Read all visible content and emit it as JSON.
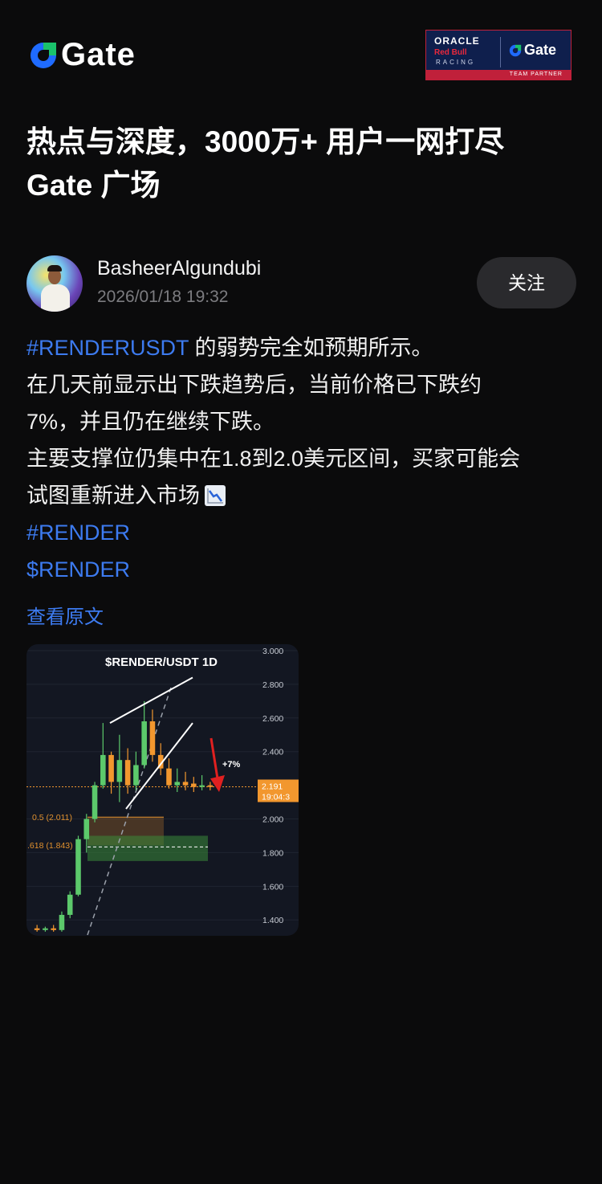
{
  "header": {
    "logo_text": "Gate",
    "partner": {
      "oracle": "ORACLE",
      "redbull": "Red Bull",
      "racing": "RACING",
      "gate": "Gate",
      "team_partner": "TEAM PARTNER"
    }
  },
  "headline": {
    "line1": "热点与深度，3000万+ 用户一网打尽",
    "line2": "Gate 广场"
  },
  "author": {
    "name": "BasheerAlgundubi",
    "time": "2026/01/18 19:32",
    "follow_label": "关注"
  },
  "post": {
    "tag_main": "#RENDERUSDT",
    "line1_rest": " 的弱势完全如预期所示。",
    "line2": "在几天前显示出下跌趋势后，当前价格已下跌约",
    "line3": "7%，并且仍在继续下跌。",
    "line4": "主要支撑位仍集中在1.8到2.0美元区间，买家可能会",
    "line5": "试图重新进入市场",
    "emoji": "chart-decreasing-icon",
    "hashtag": "#RENDER",
    "cashtag": "$RENDER",
    "view_original": "查看原文"
  },
  "colors": {
    "link": "#3d7bf0",
    "brand_blue": "#1f6bff",
    "brand_green": "#1ac26b",
    "bull": "#5cc96b",
    "bear": "#f2972e",
    "arrow": "#e02020"
  },
  "chart_data": {
    "type": "candlestick",
    "title": "$RENDER/USDT 1D",
    "y_ticks": [
      "3.000",
      "2.800",
      "2.600",
      "2.400",
      "2.000",
      "1.800",
      "1.600",
      "1.400"
    ],
    "ylim": [
      1.32,
      3.0
    ],
    "current_price": "2.191",
    "countdown": "19:04:3",
    "fib_levels": [
      {
        "label": "0.5 (2.011)",
        "value": 2.011
      },
      {
        "label": ".618 (1.843)",
        "value": 1.843
      }
    ],
    "annotation": "+7%",
    "support_zone": [
      1.75,
      1.9
    ],
    "candles": [
      {
        "o": 1.35,
        "c": 1.34,
        "h": 1.37,
        "l": 1.33
      },
      {
        "o": 1.34,
        "c": 1.35,
        "h": 1.36,
        "l": 1.33
      },
      {
        "o": 1.35,
        "c": 1.34,
        "h": 1.37,
        "l": 1.33
      },
      {
        "o": 1.34,
        "c": 1.43,
        "h": 1.45,
        "l": 1.33
      },
      {
        "o": 1.43,
        "c": 1.55,
        "h": 1.57,
        "l": 1.41
      },
      {
        "o": 1.55,
        "c": 1.88,
        "h": 1.9,
        "l": 1.54
      },
      {
        "o": 1.88,
        "c": 2.0,
        "h": 2.03,
        "l": 1.8
      },
      {
        "o": 2.0,
        "c": 2.2,
        "h": 2.22,
        "l": 1.98
      },
      {
        "o": 2.2,
        "c": 2.38,
        "h": 2.57,
        "l": 2.18
      },
      {
        "o": 2.38,
        "c": 2.22,
        "h": 2.4,
        "l": 2.15
      },
      {
        "o": 2.22,
        "c": 2.35,
        "h": 2.5,
        "l": 2.1
      },
      {
        "o": 2.35,
        "c": 2.2,
        "h": 2.42,
        "l": 2.15
      },
      {
        "o": 2.2,
        "c": 2.32,
        "h": 2.4,
        "l": 2.17
      },
      {
        "o": 2.32,
        "c": 2.58,
        "h": 2.7,
        "l": 2.3
      },
      {
        "o": 2.58,
        "c": 2.38,
        "h": 2.65,
        "l": 2.34
      },
      {
        "o": 2.38,
        "c": 2.3,
        "h": 2.45,
        "l": 2.26
      },
      {
        "o": 2.3,
        "c": 2.2,
        "h": 2.36,
        "l": 2.18
      },
      {
        "o": 2.2,
        "c": 2.22,
        "h": 2.3,
        "l": 2.16
      },
      {
        "o": 2.22,
        "c": 2.2,
        "h": 2.28,
        "l": 2.17
      },
      {
        "o": 2.21,
        "c": 2.19,
        "h": 2.25,
        "l": 2.16
      },
      {
        "o": 2.19,
        "c": 2.2,
        "h": 2.26,
        "l": 2.17
      },
      {
        "o": 2.2,
        "c": 2.19,
        "h": 2.22,
        "l": 2.17
      }
    ]
  }
}
